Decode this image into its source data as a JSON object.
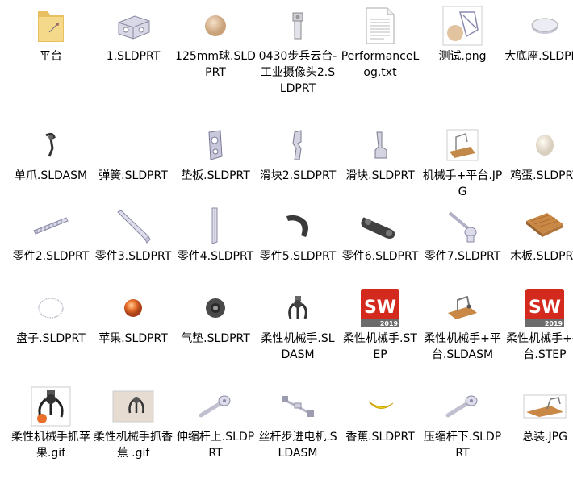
{
  "files": [
    {
      "name": "平台",
      "icon": "folder-icon"
    },
    {
      "name": "1.SLDPRT",
      "icon": "part-block-icon"
    },
    {
      "name": "125mm球.SLDPRT",
      "icon": "ball-icon"
    },
    {
      "name": "0430步兵云台-工业摄像头2.SLDPRT",
      "icon": "camera-part-icon"
    },
    {
      "name": "PerformanceLog.txt",
      "icon": "text-file-icon"
    },
    {
      "name": "测试.png",
      "icon": "image-preview-icon"
    },
    {
      "name": "大底座.SLDPRT",
      "icon": "disc-base-icon"
    },
    {
      "name": "单爪.SLDASM",
      "icon": "claw-icon"
    },
    {
      "name": "弹簧.SLDPRT",
      "icon": "blank-part-icon"
    },
    {
      "name": "垫板.SLDPRT",
      "icon": "pad-plate-icon"
    },
    {
      "name": "滑块2.SLDPRT",
      "icon": "slider-icon"
    },
    {
      "name": "滑块.SLDPRT",
      "icon": "slider-icon"
    },
    {
      "name": "机械手+平台.JPG",
      "icon": "image-preview-icon"
    },
    {
      "name": "鸡蛋.SLDPRT",
      "icon": "egg-icon"
    },
    {
      "name": "零件2.SLDPRT",
      "icon": "rack-icon"
    },
    {
      "name": "零件3.SLDPRT",
      "icon": "bar-icon"
    },
    {
      "name": "零件4.SLDPRT",
      "icon": "rod-icon"
    },
    {
      "name": "零件5.SLDPRT",
      "icon": "hook-icon"
    },
    {
      "name": "零件6.SLDPRT",
      "icon": "track-icon"
    },
    {
      "name": "零件7.SLDPRT",
      "icon": "arm-part-icon"
    },
    {
      "name": "木板.SLDPRT",
      "icon": "wood-board-icon"
    },
    {
      "name": "盘子.SLDPRT",
      "icon": "ring-icon"
    },
    {
      "name": "苹果.SLDPRT",
      "icon": "apple-icon"
    },
    {
      "name": "气垫.SLDPRT",
      "icon": "air-cushion-icon"
    },
    {
      "name": "柔性机械手.SLDASM",
      "icon": "gripper-icon"
    },
    {
      "name": "柔性机械手.STEP",
      "icon": "solidworks-icon"
    },
    {
      "name": "柔性机械手+平台.SLDASM",
      "icon": "platform-assembly-icon"
    },
    {
      "name": "柔性机械手+平台.STEP",
      "icon": "solidworks-icon"
    },
    {
      "name": "柔性机械手抓苹果.gif",
      "icon": "gif-apple-icon"
    },
    {
      "name": "柔性机械手抓香蕉 .gif",
      "icon": "gif-banana-icon"
    },
    {
      "name": "伸缩杆上.SLDPRT",
      "icon": "telescopic-rod-icon"
    },
    {
      "name": "丝杆步进电机.SLDASM",
      "icon": "screw-motor-icon"
    },
    {
      "name": "香蕉.SLDPRT",
      "icon": "banana-icon"
    },
    {
      "name": "压缩杆下.SLDPRT",
      "icon": "telescopic-rod-icon"
    },
    {
      "name": "总装.JPG",
      "icon": "image-preview-icon"
    }
  ],
  "solidworks_badge": {
    "text": "SW",
    "year": "2019"
  }
}
